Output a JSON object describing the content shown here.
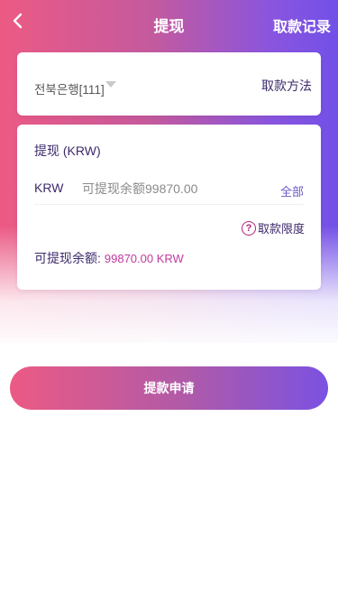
{
  "header": {
    "title": "提现",
    "records_label": "取款记录"
  },
  "bank_card": {
    "selected_bank": "전북은행[111]",
    "method_label": "取款方法"
  },
  "withdraw_card": {
    "title": "提现 (KRW)",
    "currency": "KRW",
    "amount_placeholder": "可提现余额99870.00",
    "all_label": "全部",
    "limit_label": "取款限度",
    "balance_label": "可提现余额:",
    "balance_value": "99870.00 KRW"
  },
  "submit_label": "提款申请",
  "colors": {
    "gradient_start": "#ec5a84",
    "gradient_end": "#7250e8",
    "text_dark": "#3d2a6b",
    "accent": "#c13aa0"
  }
}
